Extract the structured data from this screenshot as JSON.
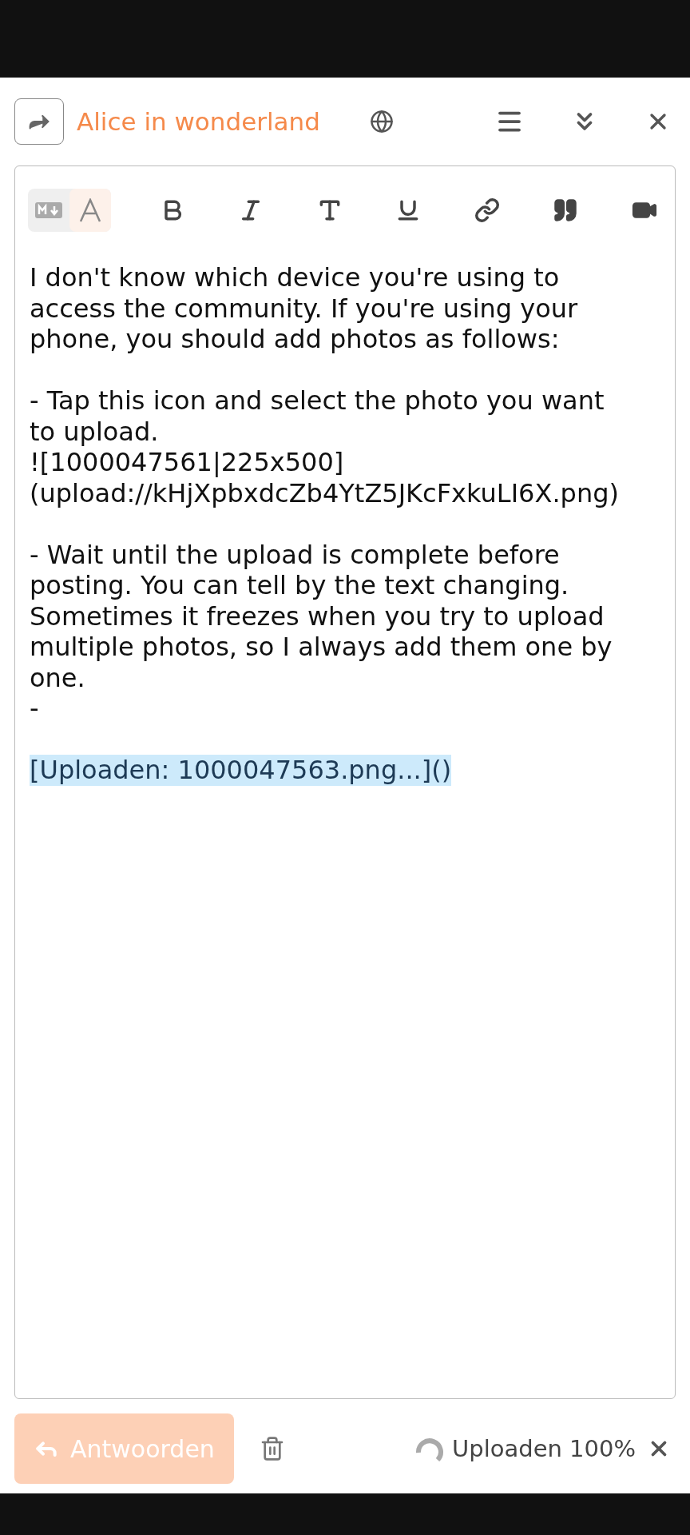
{
  "header": {
    "title": "Alice in wonderland"
  },
  "editor": {
    "mode_toggle": [
      {
        "kind": "markdown",
        "selected": false
      },
      {
        "kind": "rich_text",
        "selected": true
      }
    ],
    "paragraphs": [
      [
        "I don't know which device you're using to",
        "access the community. If you're using your",
        "phone, you should add photos as follows:"
      ],
      [
        "- Tap this icon and select the photo you want",
        "to upload.",
        "![1000047561|225x500]",
        "(upload://kHjXpbxdcZb4YtZ5JKcFxkuLI6X.png)"
      ],
      [
        "- Wait until the upload is complete before",
        "posting. You can tell by the text changing.",
        "Sometimes it freezes when you try to upload",
        "multiple photos, so I always add them one by",
        "one.",
        "-"
      ]
    ],
    "upload_placeholder": "[Uploaden: 1000047563.png...]()"
  },
  "footer": {
    "reply_button": {
      "label": "Antwoorden",
      "disabled": true
    },
    "upload_status": "Uploaden 100%"
  }
}
